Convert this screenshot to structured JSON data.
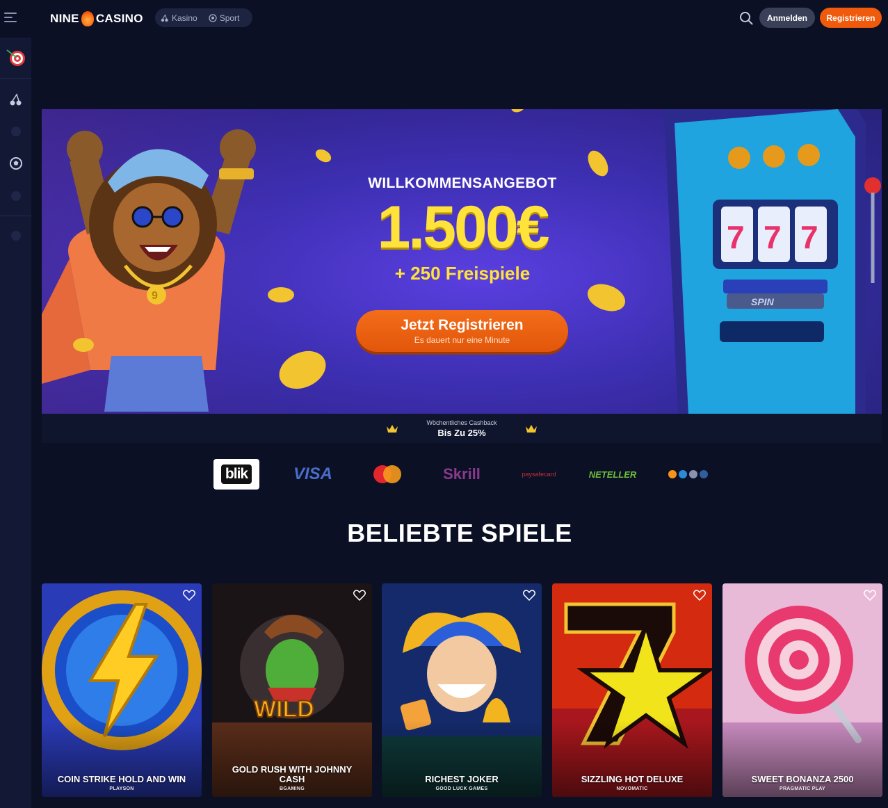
{
  "header": {
    "brand_left": "NINE",
    "brand_right": "CASINO",
    "nav": [
      {
        "label": "Kasino",
        "icon": "cherries-icon"
      },
      {
        "label": "Sport",
        "icon": "soccer-ball-icon"
      }
    ],
    "login_label": "Anmelden",
    "register_label": "Registrieren"
  },
  "sidebar": {
    "icons": [
      "target-dart-icon",
      "cherries-icon",
      "dot",
      "soccer-ball-icon",
      "dot",
      "dot"
    ]
  },
  "hero": {
    "eyebrow": "WILLKOMMENSANGEBOT",
    "amount": "1.500€",
    "sub": "+ 250 Freispiele",
    "cta_main": "Jetzt Registrieren",
    "cta_sub": "Es dauert nur eine Minute"
  },
  "cashback": {
    "small": "Wöchentliches Cashback",
    "big": "Bis Zu 25%"
  },
  "payments": {
    "blik": "blik",
    "visa": "VISA",
    "skrill": "Skrill",
    "paysafe": "paysafecard",
    "neteller": "NETELLER"
  },
  "section_title": "BELIEBTE SPIELE",
  "games": [
    {
      "title": "COIN STRIKE HOLD AND WIN",
      "provider": "PLAYSON"
    },
    {
      "title": "GOLD RUSH WITH JOHNNY CASH",
      "provider": "BGAMING"
    },
    {
      "title": "RICHEST JOKER",
      "provider": "GOOD LUCK GAMES"
    },
    {
      "title": "SIZZLING HOT DELUXE",
      "provider": "NOVOMATIC"
    },
    {
      "title": "SWEET BONANZA 2500",
      "provider": "PRAGMATIC PLAY"
    }
  ],
  "colors": {
    "background": "#0b1024",
    "accent": "#f05a0c",
    "gold": "#ffe23a",
    "hero_purple": "#3d2fb2"
  }
}
